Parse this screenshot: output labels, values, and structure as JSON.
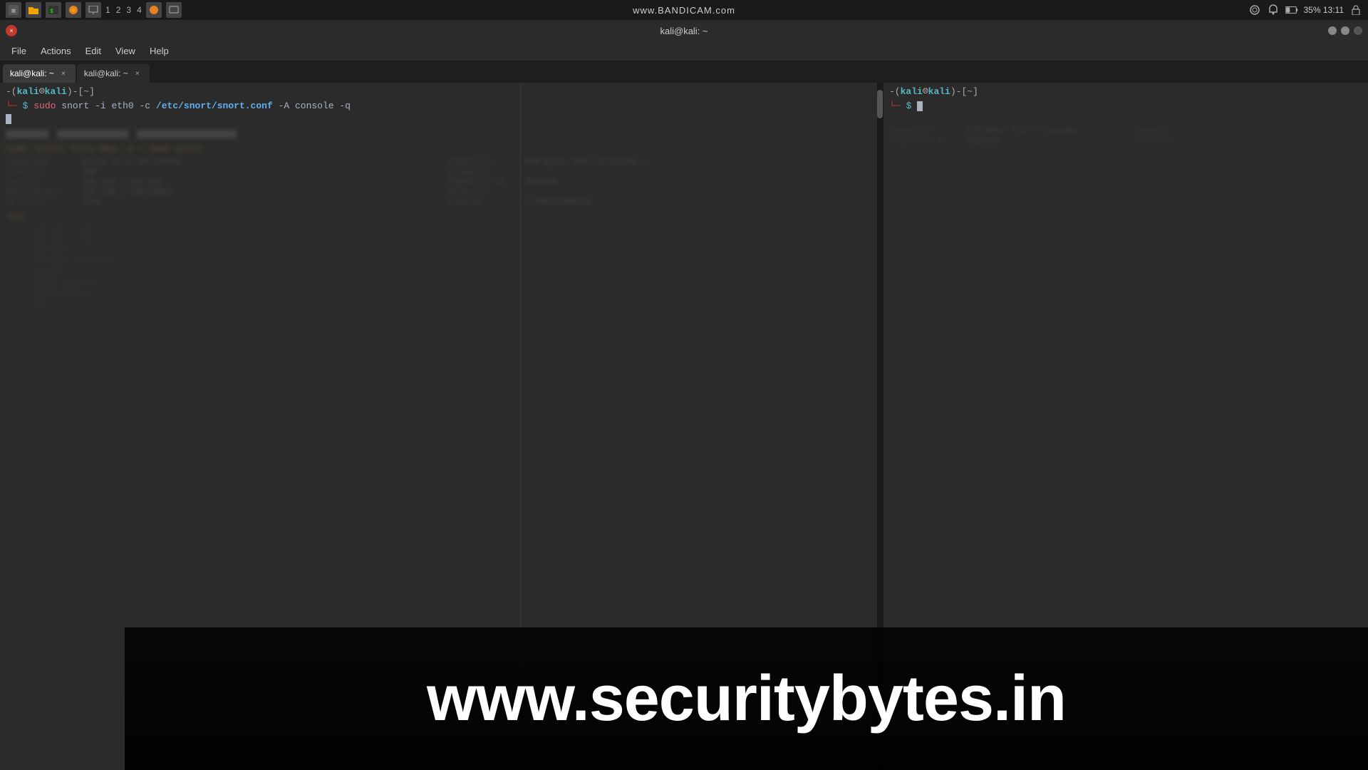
{
  "bandicam": {
    "watermark": "www.BANDICAM.com"
  },
  "systembar": {
    "title": "kali@kali: ~",
    "time": "35% 13:11",
    "battery": "35%"
  },
  "titlebar": {
    "title": "kali@kali: ~"
  },
  "menubar": {
    "file": "File",
    "actions": "Actions",
    "edit": "Edit",
    "view": "View",
    "help": "Help"
  },
  "tabs": [
    {
      "label": "kali@kali: ~",
      "active": true
    },
    {
      "label": "kali@kali: ~",
      "active": false
    }
  ],
  "terminal_left": {
    "prompt_user": "kali",
    "prompt_host": "kali",
    "prompt_dir": "~",
    "command_full": "sudo snort -i eth0 -c /etc/snort/snort.conf -A console -q",
    "cmd_sudo": "sudo",
    "cmd_snort": "snort",
    "cmd_flags": "-i eth0 -c",
    "cmd_path": "/etc/snort/snort.conf",
    "cmd_rest": "-A console -q"
  },
  "terminal_right": {
    "prompt_user": "kali",
    "prompt_host": "kali",
    "prompt_dir": "~"
  },
  "alert": {
    "text": "ALERT (34764: Proxy WAD): A.4 (9640 bytes)"
  },
  "info_fields": {
    "timestamp_label": "Timestamp:",
    "timestamp_value": "06/10-15:17:08.034761",
    "protocol_label": "Protocol:",
    "protocol_value": "TCP",
    "source_label": "Source:",
    "source_value": "192.168.1.101:443",
    "destination_label": "Destination:",
    "destination_value": "192.168.1.100:54843",
    "in_iface_label": "In Iface:",
    "in_iface_value": "eth0",
    "flow_id_label": "Flow ID:",
    "flow_id_value": "1 968231668161",
    "signature_label": "Signature:",
    "signature_value": "FTP-data: FTP://transfer...",
    "category_label": "Category:",
    "category_value": "",
    "signature_id_label": "Signature ID:",
    "signature_id_value": "2022648",
    "severity_label": "Severity:",
    "severity_value": ""
  },
  "json_label": "JSON",
  "watermark": {
    "text": "www.securitybytes.in"
  }
}
